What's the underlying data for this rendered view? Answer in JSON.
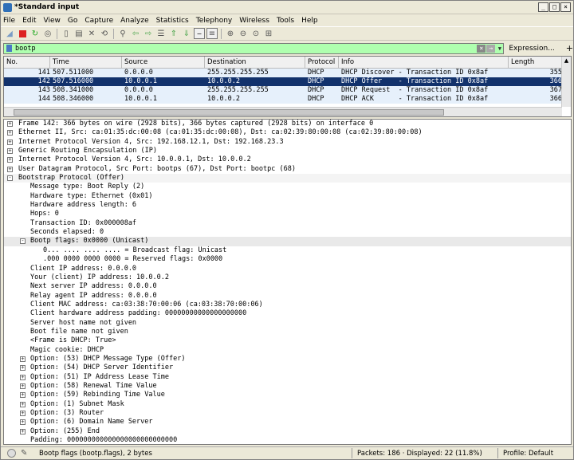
{
  "window": {
    "title": "*Standard input",
    "buttons": [
      "_",
      "□",
      "×"
    ]
  },
  "menu": [
    "File",
    "Edit",
    "View",
    "Go",
    "Capture",
    "Analyze",
    "Statistics",
    "Telephony",
    "Wireless",
    "Tools",
    "Help"
  ],
  "filter": {
    "value": "bootp",
    "expression_label": "Expression...",
    "plus_label": "+"
  },
  "packet_list": {
    "columns": [
      "No.",
      "Time",
      "Source",
      "Destination",
      "Protocol",
      "Info",
      "Length"
    ],
    "rows": [
      {
        "no": "141",
        "time": "507.511000",
        "src": "0.0.0.0",
        "dst": "255.255.255.255",
        "proto": "DHCP",
        "info": "DHCP Discover - Transaction ID 0x8af",
        "len": "355",
        "selected": false
      },
      {
        "no": "142",
        "time": "507.516000",
        "src": "10.0.0.1",
        "dst": "10.0.0.2",
        "proto": "DHCP",
        "info": "DHCP Offer    - Transaction ID 0x8af",
        "len": "366",
        "selected": true
      },
      {
        "no": "143",
        "time": "508.341000",
        "src": "0.0.0.0",
        "dst": "255.255.255.255",
        "proto": "DHCP",
        "info": "DHCP Request  - Transaction ID 0x8af",
        "len": "367",
        "selected": false
      },
      {
        "no": "144",
        "time": "508.346000",
        "src": "10.0.0.1",
        "dst": "10.0.0.2",
        "proto": "DHCP",
        "info": "DHCP ACK      - Transaction ID 0x8af",
        "len": "366",
        "selected": false
      }
    ]
  },
  "details": [
    {
      "t": "Frame 142: 366 bytes on wire (2928 bits), 366 bytes captured (2928 bits) on interface 0",
      "l": 0,
      "e": "+"
    },
    {
      "t": "Ethernet II, Src: ca:01:35:dc:00:08 (ca:01:35:dc:00:08), Dst: ca:02:39:80:00:08 (ca:02:39:80:00:08)",
      "l": 0,
      "e": "+"
    },
    {
      "t": "Internet Protocol Version 4, Src: 192.168.12.1, Dst: 192.168.23.3",
      "l": 0,
      "e": "+"
    },
    {
      "t": "Generic Routing Encapsulation (IP)",
      "l": 0,
      "e": "+"
    },
    {
      "t": "Internet Protocol Version 4, Src: 10.0.0.1, Dst: 10.0.0.2",
      "l": 0,
      "e": "+"
    },
    {
      "t": "User Datagram Protocol, Src Port: bootps (67), Dst Port: bootpc (68)",
      "l": 0,
      "e": "+"
    },
    {
      "t": "Bootstrap Protocol (Offer)",
      "l": 0,
      "e": "-",
      "top": true
    },
    {
      "t": "Message type: Boot Reply (2)",
      "l": 1,
      "e": ""
    },
    {
      "t": "Hardware type: Ethernet (0x01)",
      "l": 1,
      "e": ""
    },
    {
      "t": "Hardware address length: 6",
      "l": 1,
      "e": ""
    },
    {
      "t": "Hops: 0",
      "l": 1,
      "e": ""
    },
    {
      "t": "Transaction ID: 0x000008af",
      "l": 1,
      "e": ""
    },
    {
      "t": "Seconds elapsed: 0",
      "l": 1,
      "e": ""
    },
    {
      "t": "Bootp flags: 0x0000 (Unicast)",
      "l": 1,
      "e": "-",
      "hl": true
    },
    {
      "t": "0... .... .... .... = Broadcast flag: Unicast",
      "l": 2,
      "e": ""
    },
    {
      "t": ".000 0000 0000 0000 = Reserved flags: 0x0000",
      "l": 2,
      "e": ""
    },
    {
      "t": "Client IP address: 0.0.0.0",
      "l": 1,
      "e": ""
    },
    {
      "t": "Your (client) IP address: 10.0.0.2",
      "l": 1,
      "e": ""
    },
    {
      "t": "Next server IP address: 0.0.0.0",
      "l": 1,
      "e": ""
    },
    {
      "t": "Relay agent IP address: 0.0.0.0",
      "l": 1,
      "e": ""
    },
    {
      "t": "Client MAC address: ca:03:38:70:00:06 (ca:03:38:70:00:06)",
      "l": 1,
      "e": ""
    },
    {
      "t": "Client hardware address padding: 00000000000000000000",
      "l": 1,
      "e": ""
    },
    {
      "t": "Server host name not given",
      "l": 1,
      "e": ""
    },
    {
      "t": "Boot file name not given",
      "l": 1,
      "e": ""
    },
    {
      "t": "<Frame is DHCP: True>",
      "l": 1,
      "e": ""
    },
    {
      "t": "Magic cookie: DHCP",
      "l": 1,
      "e": ""
    },
    {
      "t": "Option: (53) DHCP Message Type (Offer)",
      "l": 1,
      "e": "+"
    },
    {
      "t": "Option: (54) DHCP Server Identifier",
      "l": 1,
      "e": "+"
    },
    {
      "t": "Option: (51) IP Address Lease Time",
      "l": 1,
      "e": "+"
    },
    {
      "t": "Option: (58) Renewal Time Value",
      "l": 1,
      "e": "+"
    },
    {
      "t": "Option: (59) Rebinding Time Value",
      "l": 1,
      "e": "+"
    },
    {
      "t": "Option: (1) Subnet Mask",
      "l": 1,
      "e": "+"
    },
    {
      "t": "Option: (3) Router",
      "l": 1,
      "e": "+"
    },
    {
      "t": "Option: (6) Domain Name Server",
      "l": 1,
      "e": "+"
    },
    {
      "t": "Option: (255) End",
      "l": 1,
      "e": "+"
    },
    {
      "t": "Padding: 000000000000000000000000000",
      "l": 1,
      "e": ""
    }
  ],
  "status": {
    "field": "Bootp flags (bootp.flags), 2 bytes",
    "packets": "Packets: 186 · Displayed: 22 (11.8%)",
    "profile": "Profile: Default"
  },
  "colors": {
    "filter_bg": "#afffaf",
    "selected_row": "#12326c",
    "row_bg": "#e6f0fb"
  }
}
